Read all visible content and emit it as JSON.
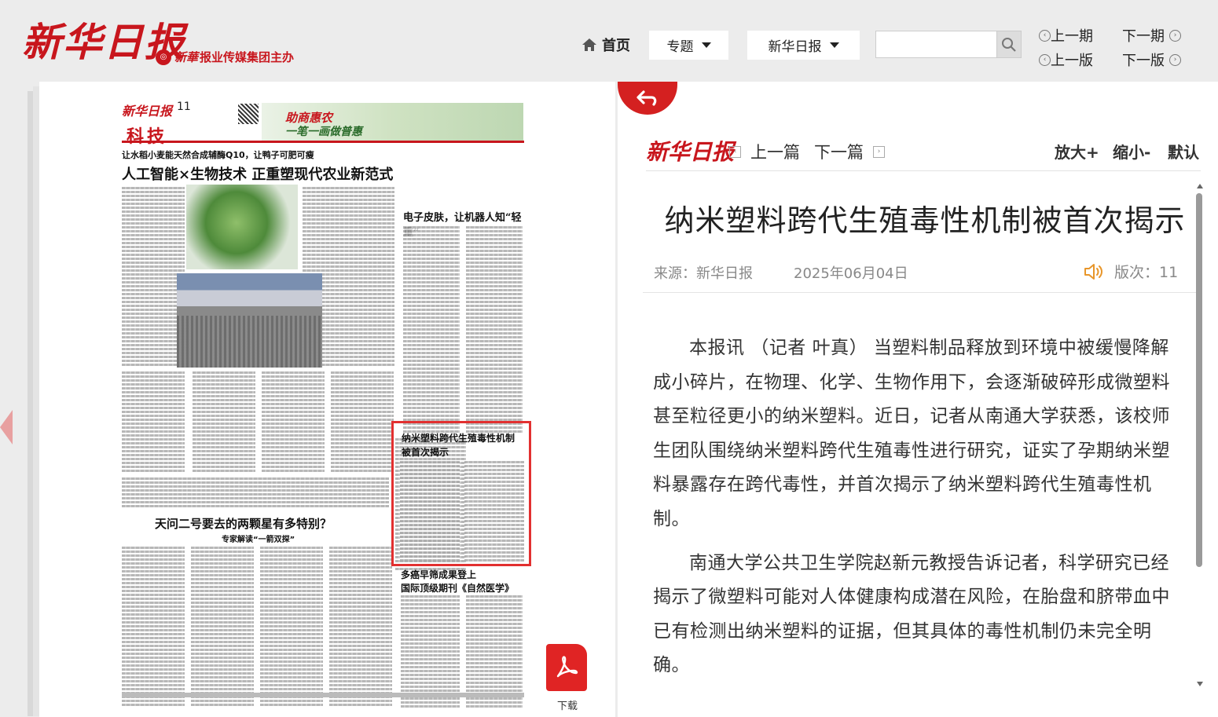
{
  "header": {
    "logo": "新华日报",
    "group_script": "新華",
    "group_text": "报业传媒集团主办",
    "nav": {
      "home": "首页",
      "topics": "专题",
      "paper": "新华日报"
    },
    "search": {
      "value": "",
      "placeholder": ""
    },
    "issue_prev": "上一期",
    "issue_next": "下一期",
    "page_prev": "上一版",
    "page_next": "下一版"
  },
  "newspaper": {
    "masthead": "新华日报",
    "page_number": "11",
    "section": "科技",
    "ad_line1": "助商惠农",
    "ad_line2": "一笔一画做普惠",
    "headline1_sub": "让水稻小麦能天然合成辅酶Q10，让鸭子可肥可瘦",
    "headline1": "人工智能×生物技术 正重塑现代农业新范式",
    "headline2": "电子皮肤，让机器人知“轻重”",
    "headline3_line1": "纳米塑料跨代生殖毒性机制",
    "headline3_line2": "被首次揭示",
    "headline4": "天问二号要去的两颗星有多特别？",
    "headline4_sub": "专家解读“一箭双探”",
    "headline5_line1": "多癌早筛成果登上",
    "headline5_line2": "国际顶级期刊《自然医学》",
    "download_label": "下载"
  },
  "article": {
    "toolbar_logo": "新华日报",
    "prev_article": "上一篇",
    "next_article": "下一篇",
    "zoom_in": "放大+",
    "zoom_out": "缩小-",
    "zoom_default": "默认",
    "title": "纳米塑料跨代生殖毒性机制被首次揭示",
    "source": "来源：新华日报",
    "date": "2025年06月04日",
    "page_label": "版次：11",
    "paragraphs": [
      "本报讯 （记者 叶真） 当塑料制品释放到环境中被缓慢降解成小碎片，在物理、化学、生物作用下，会逐渐破碎形成微塑料甚至粒径更小的纳米塑料。近日，记者从南通大学获悉，该校师生团队围绕纳米塑料跨代生殖毒性进行研究，证实了孕期纳米塑料暴露存在跨代毒性，并首次揭示了纳米塑料跨代生殖毒性机制。",
      "南通大学公共卫生学院赵新元教授告诉记者，科学研究已经揭示了微塑料可能对人体健康构成潜在风险，在胎盘和脐带血中已有检测出纳米塑料的证据，但其具体的毒性机制仍未完全明确。"
    ]
  },
  "colors": {
    "brand_red": "#c8161d",
    "highlight_red": "#e23030",
    "text_dark": "#333333",
    "text_meta": "#888888"
  }
}
